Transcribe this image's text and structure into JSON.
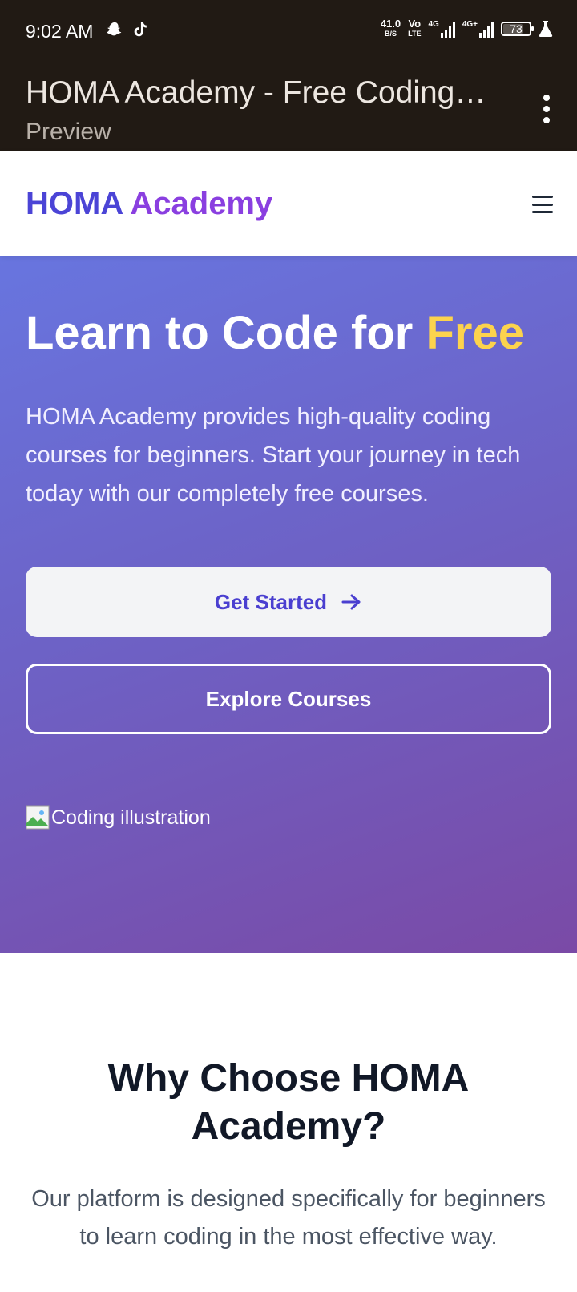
{
  "status_bar": {
    "time": "9:02 AM",
    "net_speed_value": "41.0",
    "net_speed_unit": "B/S",
    "volte_top": "Vo",
    "volte_bottom": "LTE",
    "sim1_label": "4G",
    "sim2_label": "4G+",
    "battery": "73"
  },
  "app_bar": {
    "title": "HOMA Academy - Free Coding…",
    "subtitle": "Preview"
  },
  "nav": {
    "logo_part1": "HOMA",
    "logo_part2": "Academy"
  },
  "hero": {
    "title_main": "Learn to Code for ",
    "title_highlight": "Free",
    "description": "HOMA Academy provides high-quality coding courses for beginners. Start your journey in tech today with our completely free courses.",
    "primary_button": "Get Started",
    "secondary_button": "Explore Courses",
    "image_alt": "Coding illustration"
  },
  "why": {
    "title": "Why Choose HOMA Academy?",
    "description": "Our platform is designed specifically for beginners to learn coding in the most effective way."
  },
  "colors": {
    "brand_blue": "#4b44d6",
    "brand_purple": "#8a3fe0",
    "highlight_yellow": "#fcd34d",
    "status_bar_bg": "#211a14"
  }
}
